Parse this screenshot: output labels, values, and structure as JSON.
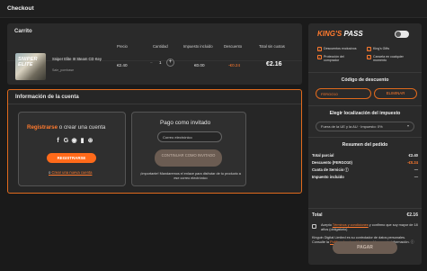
{
  "header": {
    "title": "Checkout"
  },
  "cart": {
    "title": "Carrito",
    "columns": {
      "price": "Precio",
      "quantity": "Cantidad",
      "tax": "Impuesto incluido",
      "discount": "Descuento",
      "total": "Total sin cuotas"
    },
    "item": {
      "image_text": "SNIPER ELITE",
      "name": "Sniper Elite III Steam CD Key",
      "seller": "Sale_pornbase",
      "price": "€2.40",
      "quantity_minus": "−",
      "quantity": "1",
      "quantity_plus": "+",
      "tax": "€0.00",
      "discount": "-€0.24",
      "total": "€2.16"
    }
  },
  "account": {
    "title": "Información de la cuenta",
    "register": {
      "title_link": "Registrarse",
      "title_rest": " o crear una cuenta",
      "social_icons": [
        "facebook-icon",
        "google-icon",
        "discord-icon",
        "twitch-icon",
        "steam-icon"
      ],
      "social_glyphs": [
        "f",
        "G",
        "◉",
        "▮",
        "⊛"
      ],
      "button": "REGISTRARSE",
      "create_link": "Crear una nueva cuenta",
      "create_prefix": "o"
    },
    "guest": {
      "title": "Pago como invitado",
      "email_placeholder": "Correo electrónico",
      "button": "CONTINUAR COMO INVITADO",
      "note": "¡Importante! Mandaremos el enlace para disfrutar de tu producto a ese correo electrónico"
    }
  },
  "sidebar": {
    "logo_a": "KING'S",
    "logo_b": "PASS",
    "perks": [
      "Descuentos exclusivos",
      "King's Gifts",
      "Protección del comprador",
      "Cancela en cualquier momento"
    ],
    "discount_code": {
      "title": "Código de descuento",
      "value": "FERGO10",
      "remove": "ELIMINAR"
    },
    "tax": {
      "title": "Elegir localización del impuesto",
      "selected": "Fuera de la UE y la AU · Impuesto: 0%"
    },
    "summary": {
      "title": "Resumen del pedido",
      "rows": [
        {
          "label": "Total parcial",
          "value": "€2.40"
        },
        {
          "label": "Descuento (FERGO10)",
          "value": "-€0.24"
        },
        {
          "label": "Cuota de Servicio ⓘ",
          "value": "—"
        },
        {
          "label": "Impuesto incluido",
          "value": "—"
        }
      ],
      "total_label": "Total",
      "total_value": "€2.16"
    },
    "terms": {
      "pre": "Acepto ",
      "link": "Términos y condiciones",
      "post": " y confirmo que soy mayor de 18 años (obligatorio)"
    },
    "kinguin_note": {
      "pre": "Kinguin Digital Limited es su controlador de datos personales. Consulte la ",
      "link": "Política de privacidad",
      "post": " para obtener más información. ⓘ"
    },
    "pay_button": "PAGAR"
  },
  "colors": {
    "accent": "#ff7a2e",
    "panel": "#2a2a2a",
    "background": "#1a1a1a"
  }
}
